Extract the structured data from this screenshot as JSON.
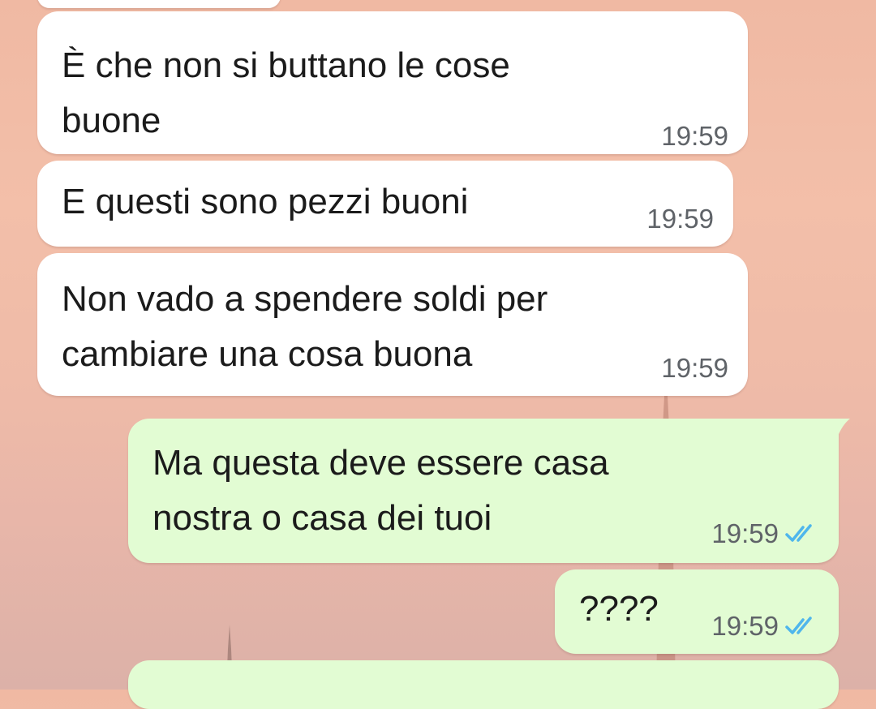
{
  "chat": {
    "messages": [
      {
        "direction": "incoming",
        "lines": [
          "È che non si buttano le cose",
          "buone"
        ],
        "time": "19:59"
      },
      {
        "direction": "incoming",
        "lines": [
          "E questi sono pezzi buoni"
        ],
        "time": "19:59"
      },
      {
        "direction": "incoming",
        "lines": [
          "Non vado a spendere soldi per",
          "cambiare una cosa buona"
        ],
        "time": "19:59"
      },
      {
        "direction": "outgoing",
        "lines": [
          "Ma questa deve essere casa",
          "nostra o casa dei tuoi"
        ],
        "time": "19:59",
        "status_icon": "double-check-read-icon"
      },
      {
        "direction": "outgoing",
        "lines": [
          "????"
        ],
        "time": "19:59",
        "status_icon": "double-check-read-icon"
      }
    ]
  },
  "colors": {
    "incoming_bubble": "#ffffff",
    "outgoing_bubble": "#e2fcd3",
    "read_ticks": "#4fb6ec",
    "timestamp": "#5f6368"
  }
}
